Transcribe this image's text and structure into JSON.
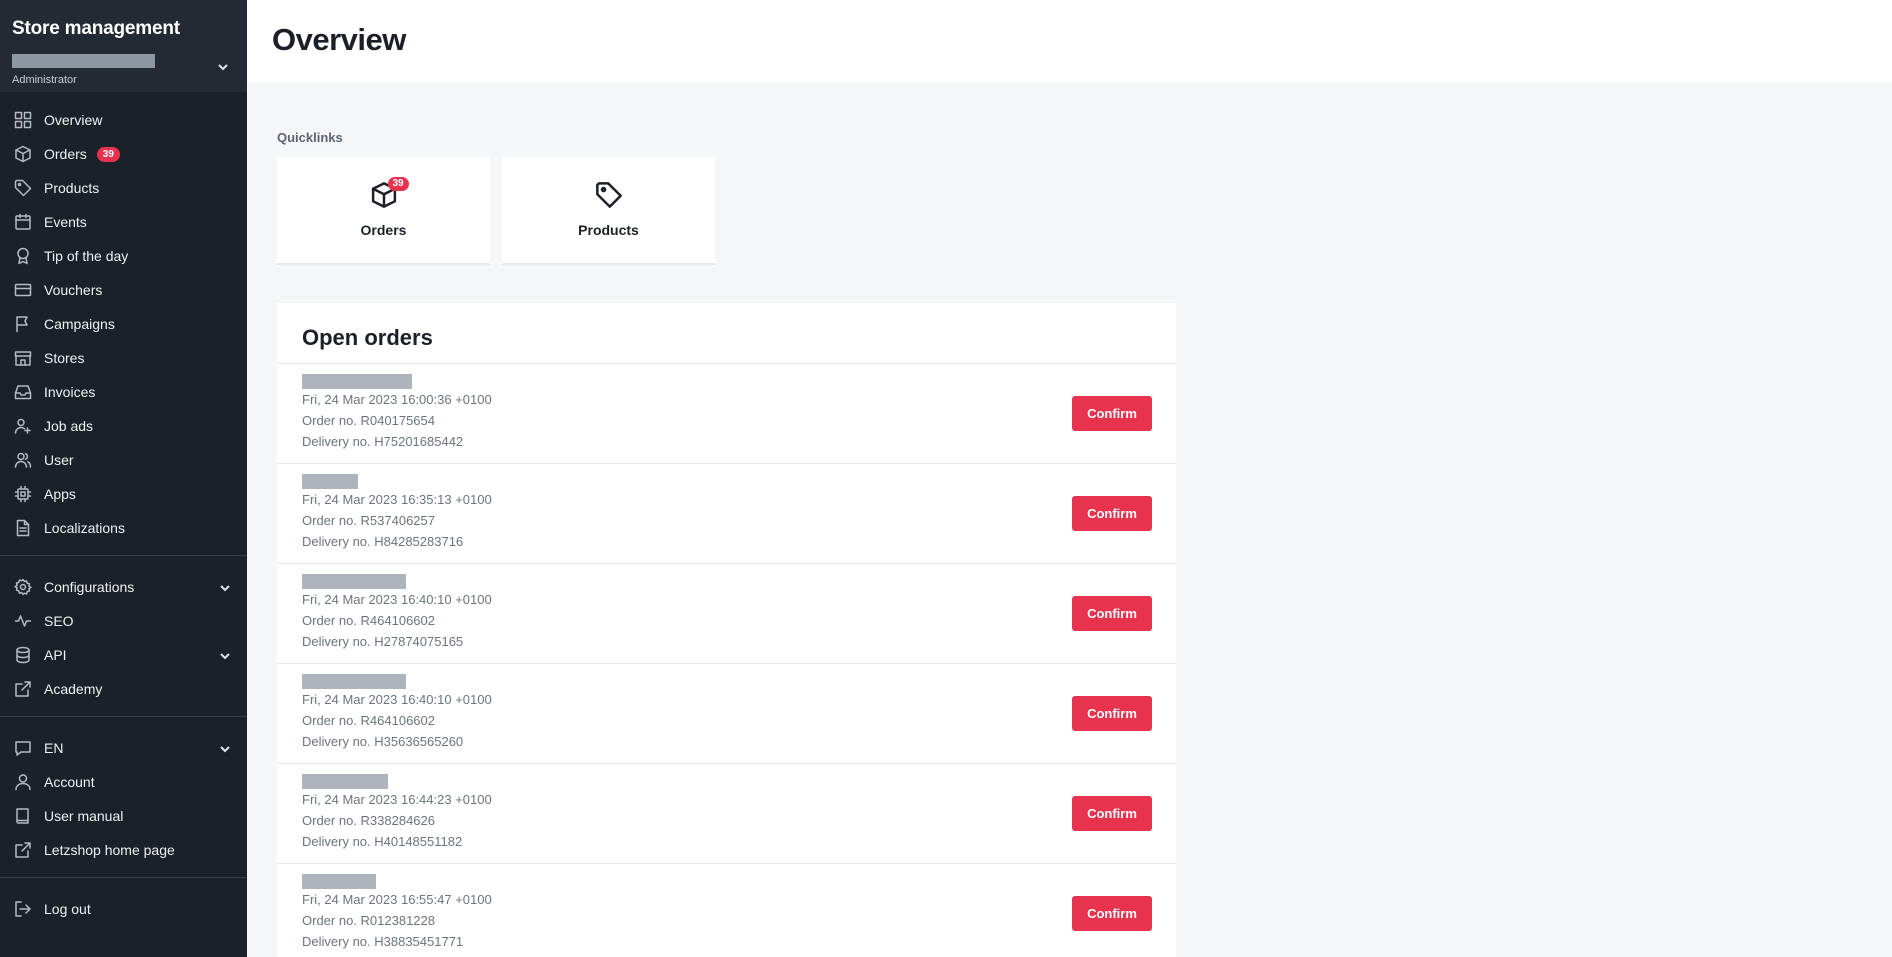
{
  "sidebar": {
    "app_title": "Store management",
    "role": "Administrator",
    "nav": [
      {
        "label": "Overview",
        "icon": "grid-icon"
      },
      {
        "label": "Orders",
        "icon": "box-icon",
        "badge": "39"
      },
      {
        "label": "Products",
        "icon": "tag-icon"
      },
      {
        "label": "Events",
        "icon": "calendar-icon"
      },
      {
        "label": "Tip of the day",
        "icon": "award-icon"
      },
      {
        "label": "Vouchers",
        "icon": "card-icon"
      },
      {
        "label": "Campaigns",
        "icon": "flag-icon"
      },
      {
        "label": "Stores",
        "icon": "storefront-icon"
      },
      {
        "label": "Invoices",
        "icon": "inbox-icon"
      },
      {
        "label": "Job ads",
        "icon": "user-sparkle-icon"
      },
      {
        "label": "User",
        "icon": "users-icon"
      },
      {
        "label": "Apps",
        "icon": "chip-icon"
      },
      {
        "label": "Localizations",
        "icon": "document-icon"
      }
    ],
    "nav2": [
      {
        "label": "Configurations",
        "icon": "gear-icon"
      },
      {
        "label": "SEO",
        "icon": "activity-icon"
      },
      {
        "label": "API",
        "icon": "database-icon"
      },
      {
        "label": "Academy",
        "icon": "external-link-icon"
      }
    ],
    "nav3": [
      {
        "label": "EN",
        "icon": "chat-icon"
      },
      {
        "label": "Account",
        "icon": "user-icon"
      },
      {
        "label": "User manual",
        "icon": "book-icon"
      },
      {
        "label": "Letzshop home page",
        "icon": "external-link-icon"
      }
    ],
    "logout": "Log out"
  },
  "main": {
    "title": "Overview",
    "quicklinks_label": "Quicklinks",
    "quicklinks": [
      {
        "label": "Orders",
        "badge": "39",
        "icon": "box-icon"
      },
      {
        "label": "Products",
        "icon": "tag-icon"
      }
    ],
    "open_orders": {
      "title": "Open orders",
      "confirm_label": "Confirm",
      "rows": [
        {
          "date": "Fri, 24 Mar 2023 16:00:36 +0100",
          "order": "Order no. R040175654",
          "delivery": "Delivery no. H75201685442"
        },
        {
          "date": "Fri, 24 Mar 2023 16:35:13 +0100",
          "order": "Order no. R537406257",
          "delivery": "Delivery no. H84285283716"
        },
        {
          "date": "Fri, 24 Mar 2023 16:40:10 +0100",
          "order": "Order no. R464106602",
          "delivery": "Delivery no. H27874075165"
        },
        {
          "date": "Fri, 24 Mar 2023 16:40:10 +0100",
          "order": "Order no. R464106602",
          "delivery": "Delivery no. H35636565260"
        },
        {
          "date": "Fri, 24 Mar 2023 16:44:23 +0100",
          "order": "Order no. R338284626",
          "delivery": "Delivery no. H40148551182"
        },
        {
          "date": "Fri, 24 Mar 2023 16:55:47 +0100",
          "order": "Order no. R012381228",
          "delivery": "Delivery no. H38835451771"
        }
      ]
    }
  },
  "colors": {
    "sidebar_bg": "#1b2129",
    "accent": "#e8334f",
    "page_bg": "#f5f6f7"
  }
}
